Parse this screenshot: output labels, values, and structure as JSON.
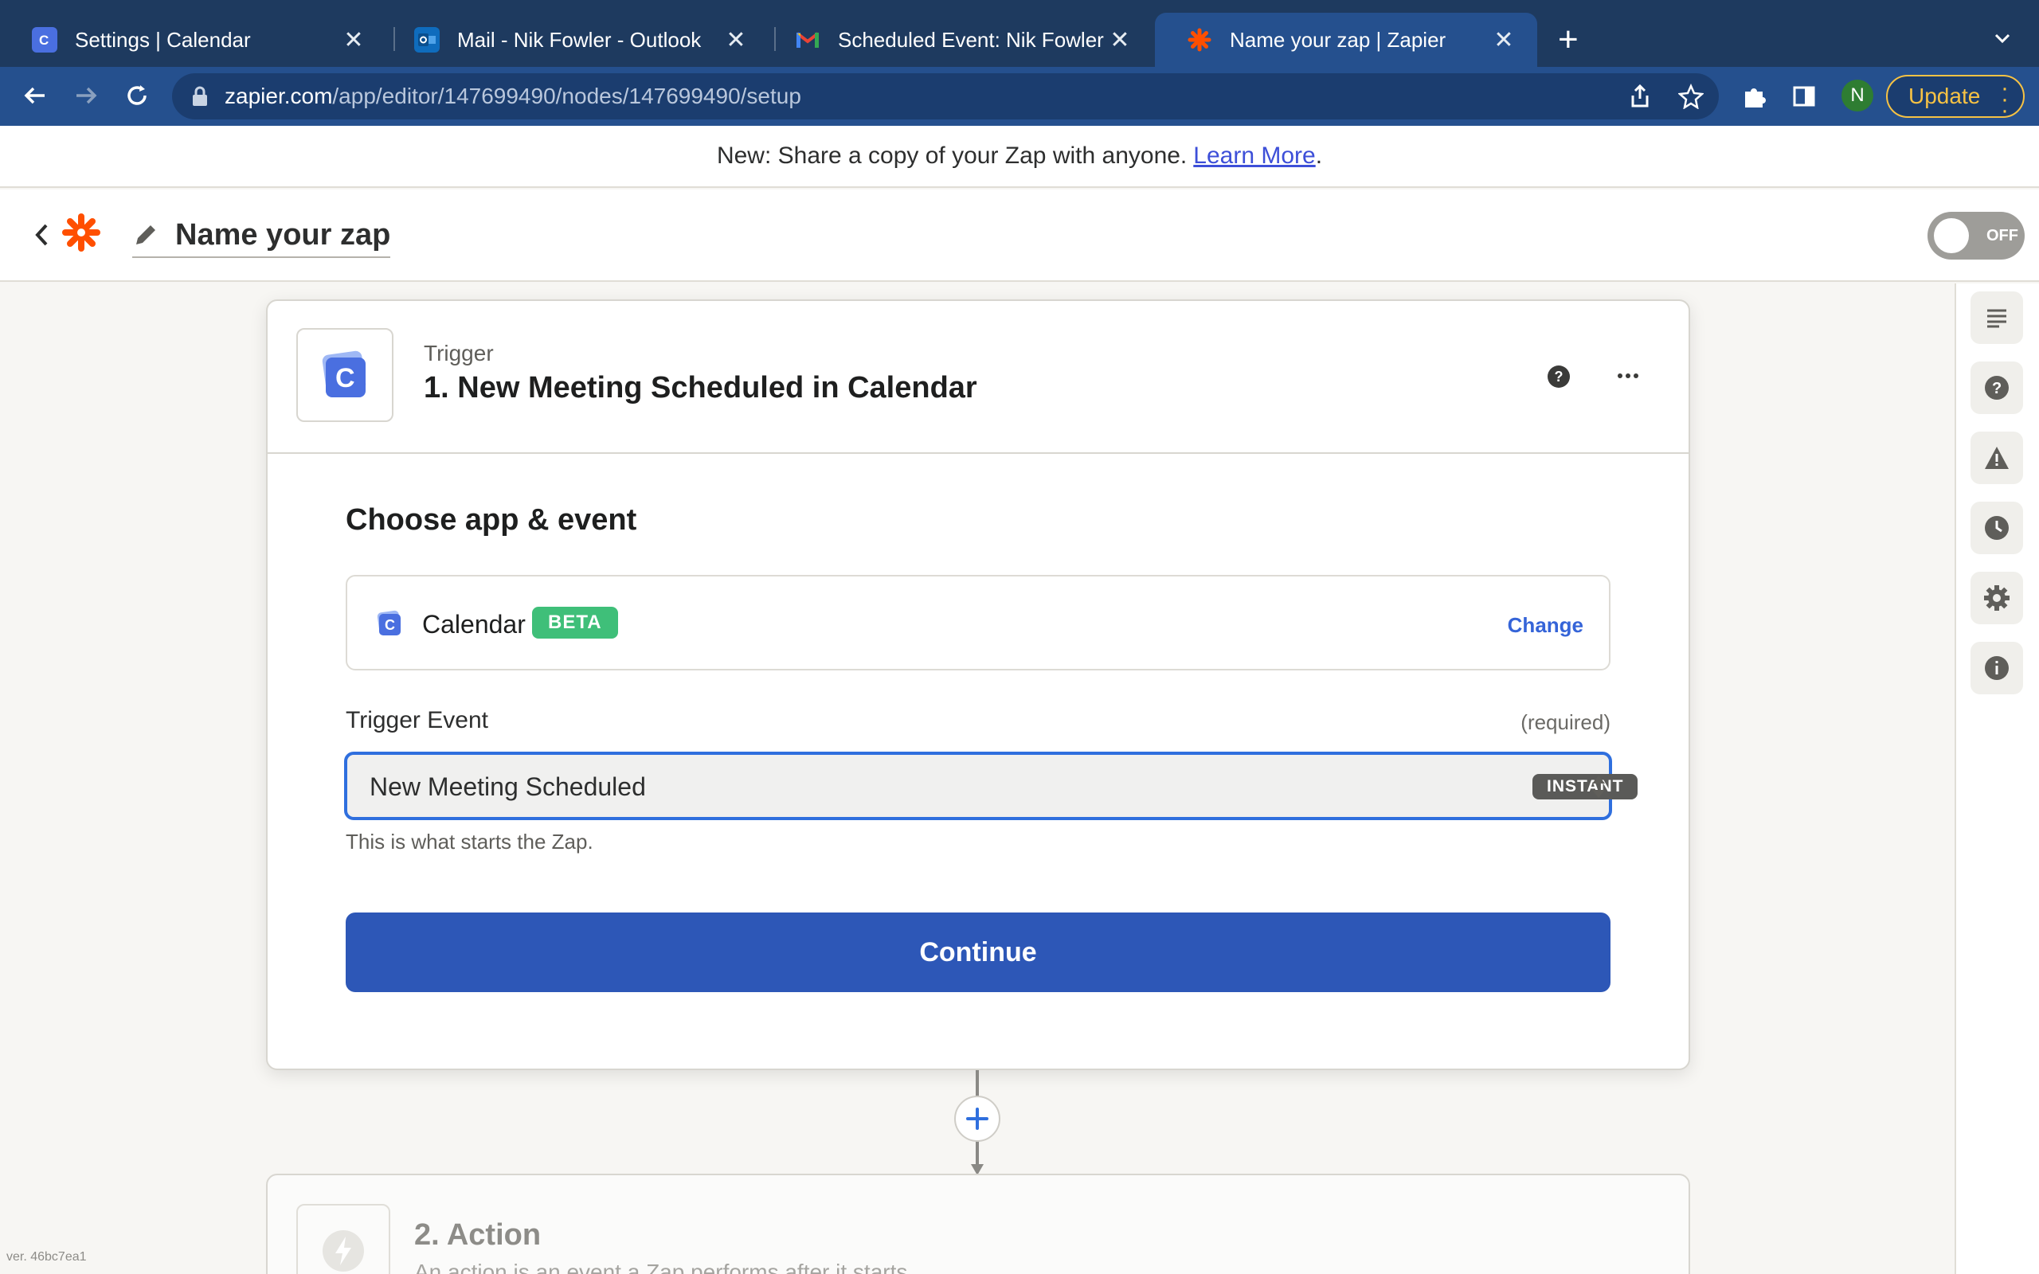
{
  "browser": {
    "tabs": [
      {
        "title": "Settings | Calendar",
        "icon": "calendar-app-icon",
        "active": false
      },
      {
        "title": "Mail - Nik Fowler - Outlook",
        "icon": "outlook-icon",
        "active": false
      },
      {
        "title": "Scheduled Event: Nik Fowler @",
        "icon": "gmail-icon",
        "active": false
      },
      {
        "title": "Name your zap | Zapier",
        "icon": "zapier-icon",
        "active": true
      }
    ],
    "url_host": "zapier.com",
    "url_path": "/app/editor/147699490/nodes/147699490/setup",
    "profile_initial": "N",
    "update_label": "Update"
  },
  "announcement": {
    "text": "New: Share a copy of your Zap with anyone.",
    "link": "Learn More",
    "trailing": "."
  },
  "zap": {
    "name": "Name your zap",
    "toggle_label": "OFF"
  },
  "trigger": {
    "kicker": "Trigger",
    "title": "1. New Meeting Scheduled in Calendar",
    "section_title": "Choose app & event",
    "app_name": "Calendar",
    "app_badge": "BETA",
    "change_label": "Change",
    "event_label": "Trigger Event",
    "event_required": "(required)",
    "event_value": "New Meeting Scheduled",
    "event_badge": "INSTANT",
    "helper": "This is what starts the Zap.",
    "continue_label": "Continue"
  },
  "action": {
    "title": "2. Action",
    "subtitle": "An action is an event a Zap performs after it starts"
  },
  "version": "ver. 46bc7ea1",
  "colors": {
    "primary": "#2d57b7",
    "focus": "#2f6fde",
    "beta": "#3fbf79",
    "zapier_orange": "#ff4f00",
    "chrome_dark": "#1e3a5f"
  }
}
